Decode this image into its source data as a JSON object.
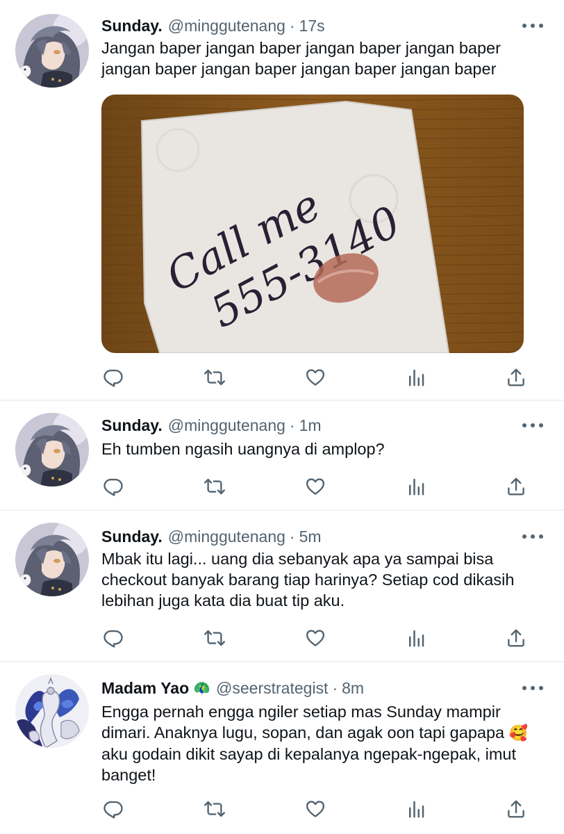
{
  "tweets": [
    {
      "name": "Sunday.",
      "handle": "@minggutenang",
      "time": "17s",
      "text": "Jangan baper jangan baper jangan baper jangan baper jangan baper jangan baper jangan baper jangan baper",
      "media": {
        "note_line1": "Call me",
        "note_line2": "555-3140"
      }
    },
    {
      "name": "Sunday.",
      "handle": "@minggutenang",
      "time": "1m",
      "text": "Eh tumben ngasih uangnya di amplop?"
    },
    {
      "name": "Sunday.",
      "handle": "@minggutenang",
      "time": "5m",
      "text": "Mbak itu lagi... uang dia sebanyak apa ya sampai bisa checkout banyak barang tiap harinya? Setiap cod dikasih lebihan juga kata dia buat tip aku."
    },
    {
      "name": "Madam Yao",
      "name_emoji": "🦚",
      "handle": "@seerstrategist",
      "time": "8m",
      "text": "Engga pernah engga ngiler setiap mas Sunday mampir dimari. Anaknya lugu, sopan, dan agak oon tapi gapapa",
      "text_emoji": "🥰",
      "text_after": " aku godain dikit sayap di kepalanya ngepak-ngepak, imut banget!"
    }
  ],
  "separator": "·",
  "icons": {
    "reply": "reply-icon",
    "retweet": "retweet-icon",
    "like": "heart-icon",
    "views": "analytics-icon",
    "share": "share-icon",
    "more": "more-icon"
  },
  "colors": {
    "text": "#0f1419",
    "secondary": "#536471",
    "divider": "#eff3f4"
  }
}
